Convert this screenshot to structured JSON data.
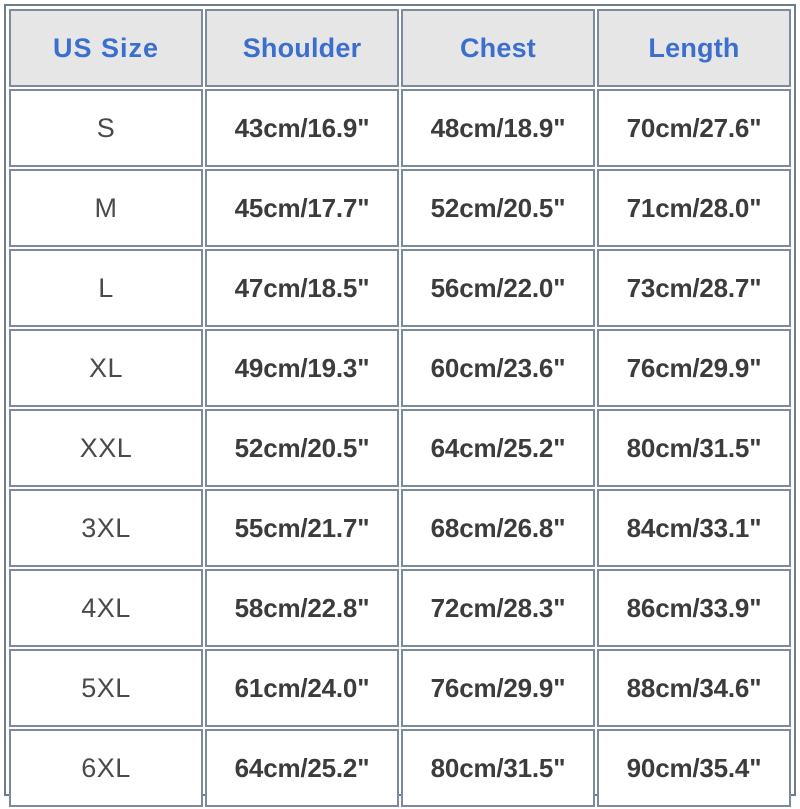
{
  "chart_data": {
    "type": "table",
    "title": "",
    "columns": [
      "US  Size",
      "Shoulder",
      "Chest",
      "Length"
    ],
    "rows": [
      {
        "size": "S",
        "shoulder": "43cm/16.9\"",
        "chest": "48cm/18.9\"",
        "length": "70cm/27.6\""
      },
      {
        "size": "M",
        "shoulder": "45cm/17.7\"",
        "chest": "52cm/20.5\"",
        "length": "71cm/28.0\""
      },
      {
        "size": "L",
        "shoulder": "47cm/18.5\"",
        "chest": "56cm/22.0\"",
        "length": "73cm/28.7\""
      },
      {
        "size": "XL",
        "shoulder": "49cm/19.3\"",
        "chest": "60cm/23.6\"",
        "length": "76cm/29.9\""
      },
      {
        "size": "XXL",
        "shoulder": "52cm/20.5\"",
        "chest": "64cm/25.2\"",
        "length": "80cm/31.5\""
      },
      {
        "size": "3XL",
        "shoulder": "55cm/21.7\"",
        "chest": "68cm/26.8\"",
        "length": "84cm/33.1\""
      },
      {
        "size": "4XL",
        "shoulder": "58cm/22.8\"",
        "chest": "72cm/28.3\"",
        "length": "86cm/33.9\""
      },
      {
        "size": "5XL",
        "shoulder": "61cm/24.0\"",
        "chest": "76cm/29.9\"",
        "length": "88cm/34.6\""
      },
      {
        "size": "6XL",
        "shoulder": "64cm/25.2\"",
        "chest": "80cm/31.5\"",
        "length": "90cm/35.4\""
      }
    ]
  },
  "table": {
    "headers": {
      "us_size": "US  Size",
      "shoulder": "Shoulder",
      "chest": "Chest",
      "length": "Length"
    },
    "rows": [
      {
        "size": "S",
        "shoulder": "43cm/16.9\"",
        "chest": "48cm/18.9\"",
        "length": "70cm/27.6\""
      },
      {
        "size": "M",
        "shoulder": "45cm/17.7\"",
        "chest": "52cm/20.5\"",
        "length": "71cm/28.0\""
      },
      {
        "size": "L",
        "shoulder": "47cm/18.5\"",
        "chest": "56cm/22.0\"",
        "length": "73cm/28.7\""
      },
      {
        "size": "XL",
        "shoulder": "49cm/19.3\"",
        "chest": "60cm/23.6\"",
        "length": "76cm/29.9\""
      },
      {
        "size": "XXL",
        "shoulder": "52cm/20.5\"",
        "chest": "64cm/25.2\"",
        "length": "80cm/31.5\""
      },
      {
        "size": "3XL",
        "shoulder": "55cm/21.7\"",
        "chest": "68cm/26.8\"",
        "length": "84cm/33.1\""
      },
      {
        "size": "4XL",
        "shoulder": "58cm/22.8\"",
        "chest": "72cm/28.3\"",
        "length": "86cm/33.9\""
      },
      {
        "size": "5XL",
        "shoulder": "61cm/24.0\"",
        "chest": "76cm/29.9\"",
        "length": "88cm/34.6\""
      },
      {
        "size": "6XL",
        "shoulder": "64cm/25.2\"",
        "chest": "80cm/31.5\"",
        "length": "90cm/35.4\""
      }
    ]
  },
  "colors": {
    "header_text": "#3b6fce",
    "header_background": "#e6e6e6",
    "cell_text": "#3c3c3c",
    "size_label_text": "#4a4a4a",
    "border": "#7b8a9c",
    "cell_background": "#ffffff"
  }
}
